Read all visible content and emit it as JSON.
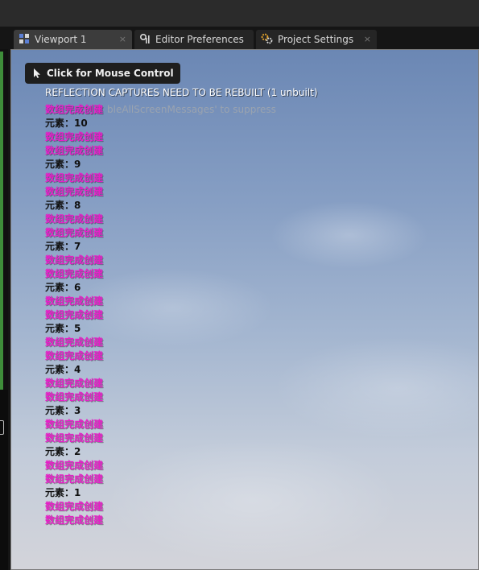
{
  "tabs": [
    {
      "label": "Viewport 1",
      "active": true,
      "icon": "viewport-grid-icon"
    },
    {
      "label": "Editor Preferences",
      "active": false,
      "icon": "preferences-icon"
    },
    {
      "label": "Project Settings",
      "active": false,
      "icon": "settings-gear-icon"
    }
  ],
  "tab_close_glyph": "×",
  "viewport": {
    "mouse_control_label": "Click for Mouse Control",
    "reflection_message": "REFLECTION CAPTURES NEED TO BE REBUILT (1 unbuilt)",
    "suppress_hint_visible": "bleAllScreenMessages' to suppress",
    "log_lines": [
      {
        "text": "数组完成创建",
        "color": "pink"
      },
      {
        "text": "元素：10",
        "color": "black"
      },
      {
        "text": "数组完成创建",
        "color": "pink"
      },
      {
        "text": "数组完成创建",
        "color": "pink"
      },
      {
        "text": "元素：9",
        "color": "black"
      },
      {
        "text": "数组完成创建",
        "color": "pink"
      },
      {
        "text": "数组完成创建",
        "color": "pink"
      },
      {
        "text": "元素：8",
        "color": "black"
      },
      {
        "text": "数组完成创建",
        "color": "pink"
      },
      {
        "text": "数组完成创建",
        "color": "pink"
      },
      {
        "text": "元素：7",
        "color": "black"
      },
      {
        "text": "数组完成创建",
        "color": "pink"
      },
      {
        "text": "数组完成创建",
        "color": "pink"
      },
      {
        "text": "元素：6",
        "color": "black"
      },
      {
        "text": "数组完成创建",
        "color": "pink"
      },
      {
        "text": "数组完成创建",
        "color": "pink"
      },
      {
        "text": "元素：5",
        "color": "black"
      },
      {
        "text": "数组完成创建",
        "color": "pink"
      },
      {
        "text": "数组完成创建",
        "color": "pink"
      },
      {
        "text": "元素：4",
        "color": "black"
      },
      {
        "text": "数组完成创建",
        "color": "pink"
      },
      {
        "text": "数组完成创建",
        "color": "pink"
      },
      {
        "text": "元素：3",
        "color": "black"
      },
      {
        "text": "数组完成创建",
        "color": "pink"
      },
      {
        "text": "数组完成创建",
        "color": "pink"
      },
      {
        "text": "元素：2",
        "color": "black"
      },
      {
        "text": "数组完成创建",
        "color": "pink"
      },
      {
        "text": "数组完成创建",
        "color": "pink"
      },
      {
        "text": "元素：1",
        "color": "black"
      },
      {
        "text": "数组完成创建",
        "color": "pink"
      },
      {
        "text": "数组完成创建",
        "color": "pink"
      }
    ]
  },
  "colors": {
    "log_pink": "#e81ec8",
    "log_black": "#111111",
    "tab_active_bg": "#3c3c3c",
    "panel_green": "#3e8e3a"
  }
}
